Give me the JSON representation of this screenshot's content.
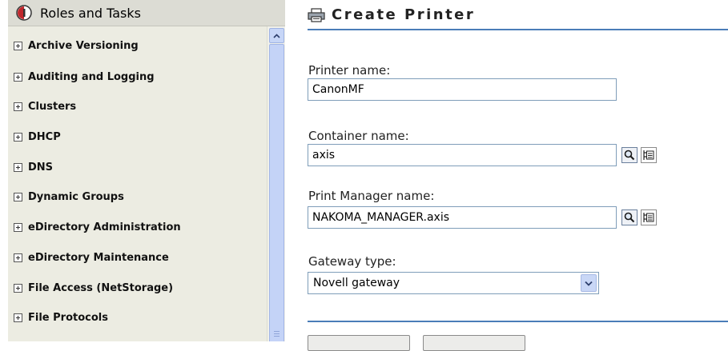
{
  "sidebar": {
    "title": "Roles and Tasks",
    "items": [
      {
        "label": "Archive Versioning"
      },
      {
        "label": "Auditing and Logging"
      },
      {
        "label": "Clusters"
      },
      {
        "label": "DHCP"
      },
      {
        "label": "DNS"
      },
      {
        "label": "Dynamic Groups"
      },
      {
        "label": "eDirectory Administration"
      },
      {
        "label": "eDirectory Maintenance"
      },
      {
        "label": "File Access (NetStorage)"
      },
      {
        "label": "File Protocols"
      }
    ],
    "icons": {
      "header": "novell-roles-icon",
      "expand": "plus-box-icon"
    }
  },
  "page": {
    "title": "Create Printer",
    "icon": "printer-icon"
  },
  "form": {
    "printer_name": {
      "label": "Printer name:",
      "value": "CanonMF"
    },
    "container_name": {
      "label": "Container name:",
      "value": "axis"
    },
    "print_manager": {
      "label": "Print Manager name:",
      "value": "NAKOMA_MANAGER.axis"
    },
    "gateway": {
      "label": "Gateway type:",
      "selected": "Novell gateway"
    }
  },
  "buttons": {
    "next": "",
    "cancel": ""
  },
  "colors": {
    "accent": "#4a7db8",
    "sidebar_bg": "#ecece2",
    "header_bg": "#dcdcd4",
    "scroll": "#c4d3f7"
  }
}
